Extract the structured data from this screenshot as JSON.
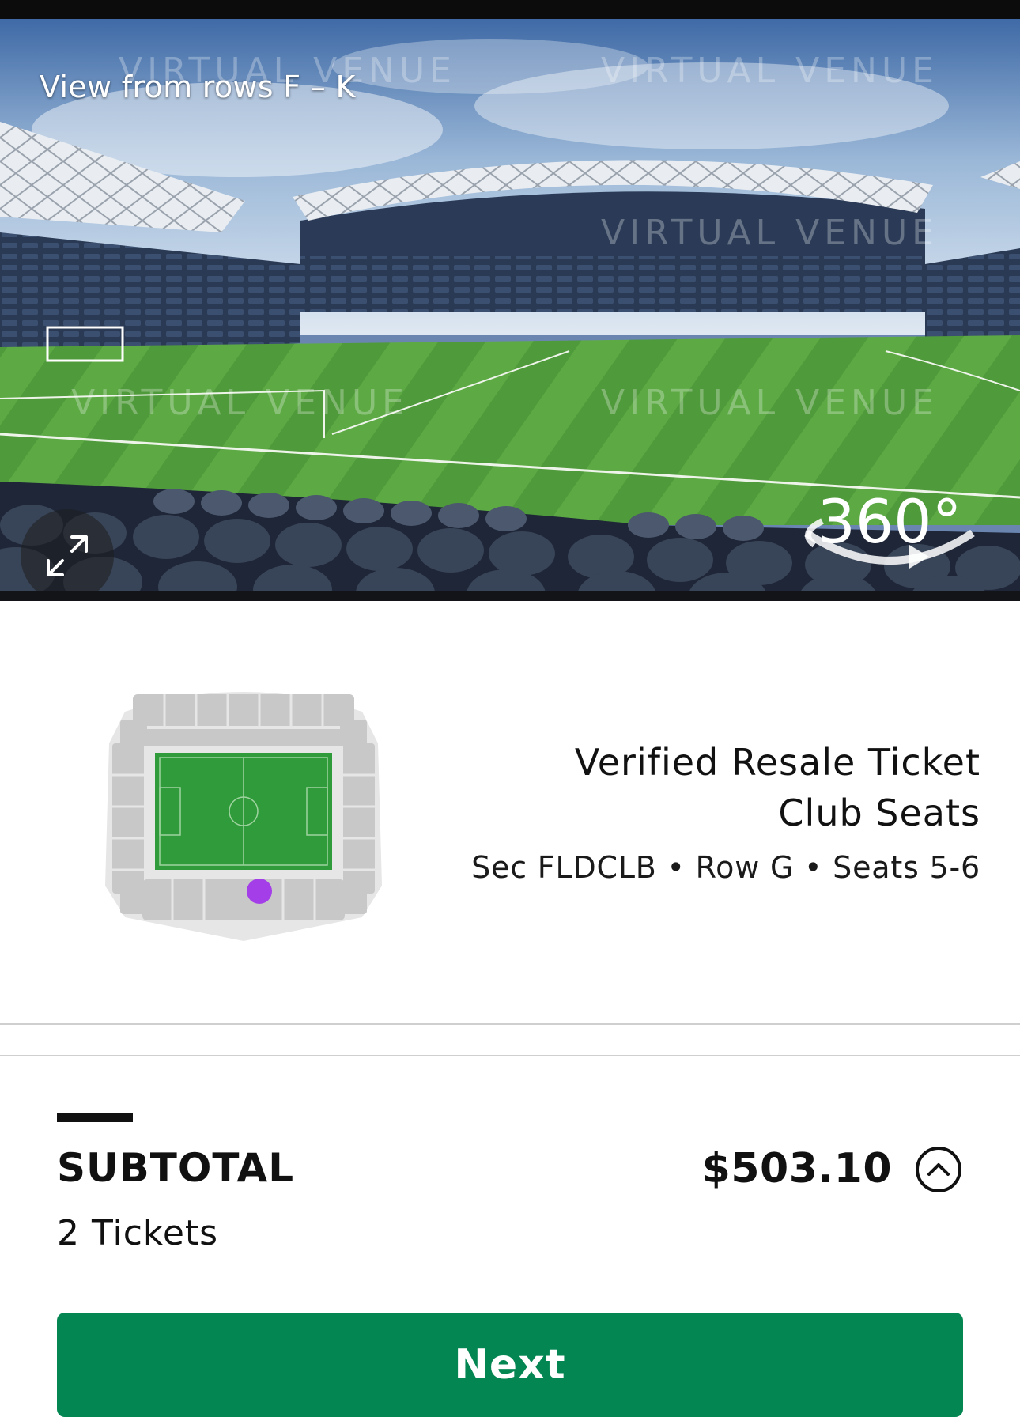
{
  "venue_view": {
    "caption": "View from rows F – K",
    "badge": "360°",
    "expand_icon": "expand-arrows-icon"
  },
  "ticket": {
    "type": "Verified Resale Ticket",
    "area": "Club Seats",
    "seats": "Sec FLDCLB • Row G • Seats 5-6",
    "seat_marker_color": "#a43ee8"
  },
  "summary": {
    "label": "SUBTOTAL",
    "ticket_count": "2 Tickets",
    "price": "$503.10",
    "toggle_icon": "chevron-up-icon"
  },
  "actions": {
    "next_label": "Next"
  },
  "colors": {
    "accent": "#038651",
    "pitch": "#2f9b3a",
    "seat_marker": "#a43ee8"
  }
}
